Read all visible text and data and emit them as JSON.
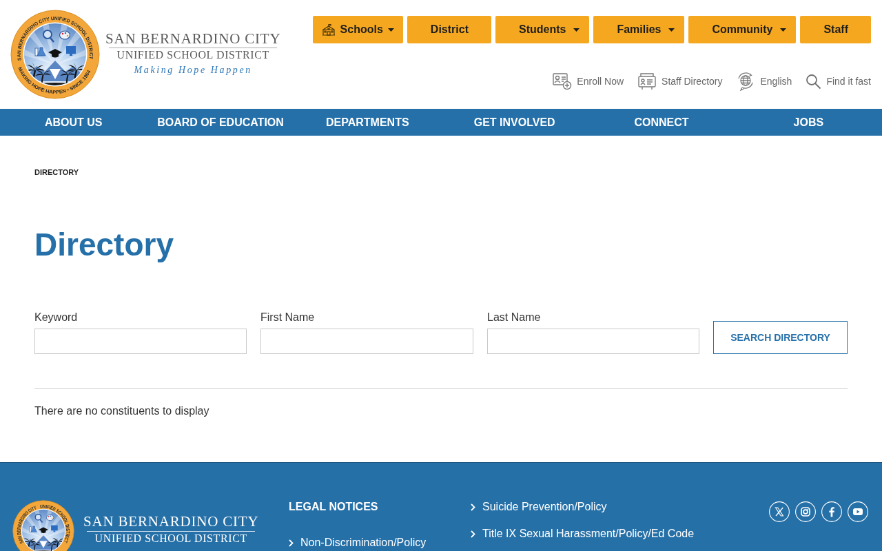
{
  "header": {
    "logo": {
      "seal_top_text": "SAN BERNARDINO CITY UNIFIED SCHOOL DISTRICT",
      "seal_bottom_text": "MAKING HOPE HAPPEN • SINCE 1964",
      "name_line_1": "SAN BERNARDINO CITY",
      "name_line_2": "UNIFIED SCHOOL DISTRICT",
      "tagline": "Making Hope Happen"
    },
    "audience_buttons": [
      {
        "label": "Schools",
        "has_icon": true,
        "has_menu": true
      },
      {
        "label": "District",
        "has_icon": false,
        "has_menu": false
      },
      {
        "label": "Students",
        "has_icon": false,
        "has_menu": true
      },
      {
        "label": "Families",
        "has_icon": false,
        "has_menu": true
      },
      {
        "label": "Community",
        "has_icon": false,
        "has_menu": true
      },
      {
        "label": "Staff",
        "has_icon": false,
        "has_menu": false
      }
    ],
    "utility_links": [
      {
        "label": "Enroll Now"
      },
      {
        "label": "Staff Directory"
      },
      {
        "label": "English"
      },
      {
        "label": "Find it fast"
      }
    ]
  },
  "main_nav": {
    "items": [
      {
        "label": "ABOUT US"
      },
      {
        "label": "BOARD OF EDUCATION"
      },
      {
        "label": "DEPARTMENTS"
      },
      {
        "label": "GET INVOLVED"
      },
      {
        "label": "CONNECT"
      },
      {
        "label": "JOBS"
      }
    ]
  },
  "breadcrumb": {
    "current": "DIRECTORY"
  },
  "page_title": "Directory",
  "search_form": {
    "fields": [
      {
        "label": "Keyword"
      },
      {
        "label": "First Name"
      },
      {
        "label": "Last Name"
      }
    ],
    "button": "SEARCH DIRECTORY"
  },
  "results": {
    "message": "There are no constituents to display"
  },
  "footer": {
    "logo": {
      "seal_text_parts": [
        "SAN BERNARDINO CITY",
        "UNIFIED SCHOOL DISTRICT"
      ],
      "name_line_1": "SAN BERNARDINO CITY",
      "name_line_2": "UNIFIED SCHOOL DISTRICT"
    },
    "legal_notices": {
      "heading": "LEGAL NOTICES",
      "links": [
        "Non-Discrimination/Policy"
      ]
    },
    "links": [
      "Suicide Prevention/Policy",
      "Title IX Sexual Harassment/Policy/Ed Code"
    ]
  }
}
